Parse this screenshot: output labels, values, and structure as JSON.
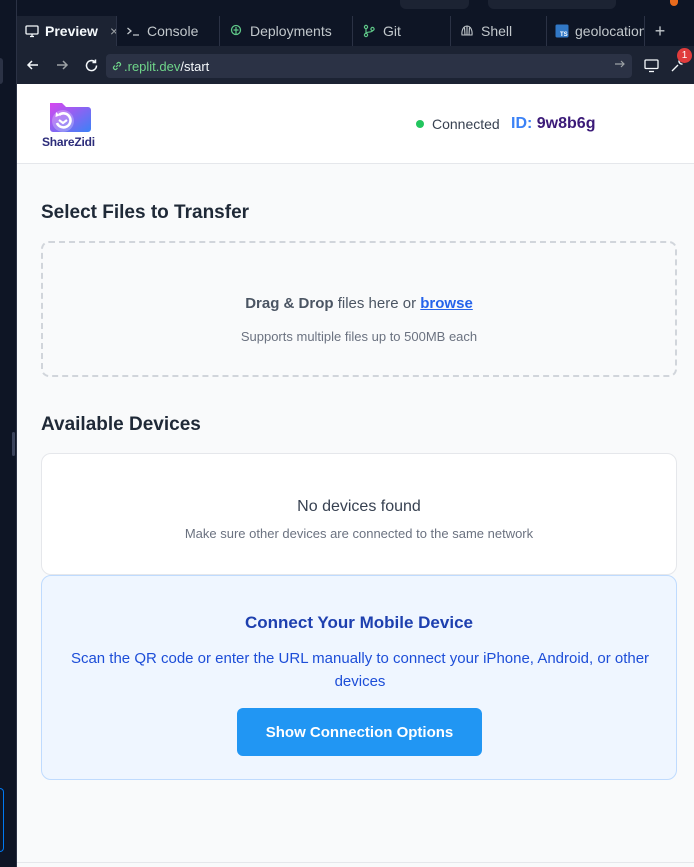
{
  "browser": {
    "tabs": [
      {
        "label": "Preview",
        "icon": "monitor-icon",
        "active": true,
        "close": "×"
      },
      {
        "label": "Console",
        "icon": "terminal-icon",
        "active": false
      },
      {
        "label": "Deployments",
        "icon": "deployments-icon",
        "active": false
      },
      {
        "label": "Git",
        "icon": "git-icon",
        "active": false
      },
      {
        "label": "Shell",
        "icon": "shell-icon",
        "active": false
      },
      {
        "label": "geolocation",
        "icon": "typescript-file-icon",
        "active": false
      }
    ],
    "add_tab": "+",
    "url_host": ".replit.dev",
    "url_path": "/start",
    "notification_count": "1"
  },
  "app": {
    "logo_text": "ShareZidi",
    "status_text": "Connected",
    "status_color": "#22c55e",
    "id_label": "ID:",
    "id_value": "9w8b6g"
  },
  "upload": {
    "heading": "Select Files to Transfer",
    "drop_bold": "Drag & Drop",
    "drop_text": " files here or ",
    "browse_link": "browse",
    "hint": "Supports multiple files up to 500MB each"
  },
  "devices": {
    "heading": "Available Devices",
    "empty_title": "No devices found",
    "empty_hint": "Make sure other devices are connected to the same network"
  },
  "mobile": {
    "title": "Connect Your Mobile Device",
    "description": "Scan the QR code or enter the URL manually to connect your iPhone, Android, or other devices",
    "button_label": "Show Connection Options",
    "button_color": "#2196f3"
  }
}
